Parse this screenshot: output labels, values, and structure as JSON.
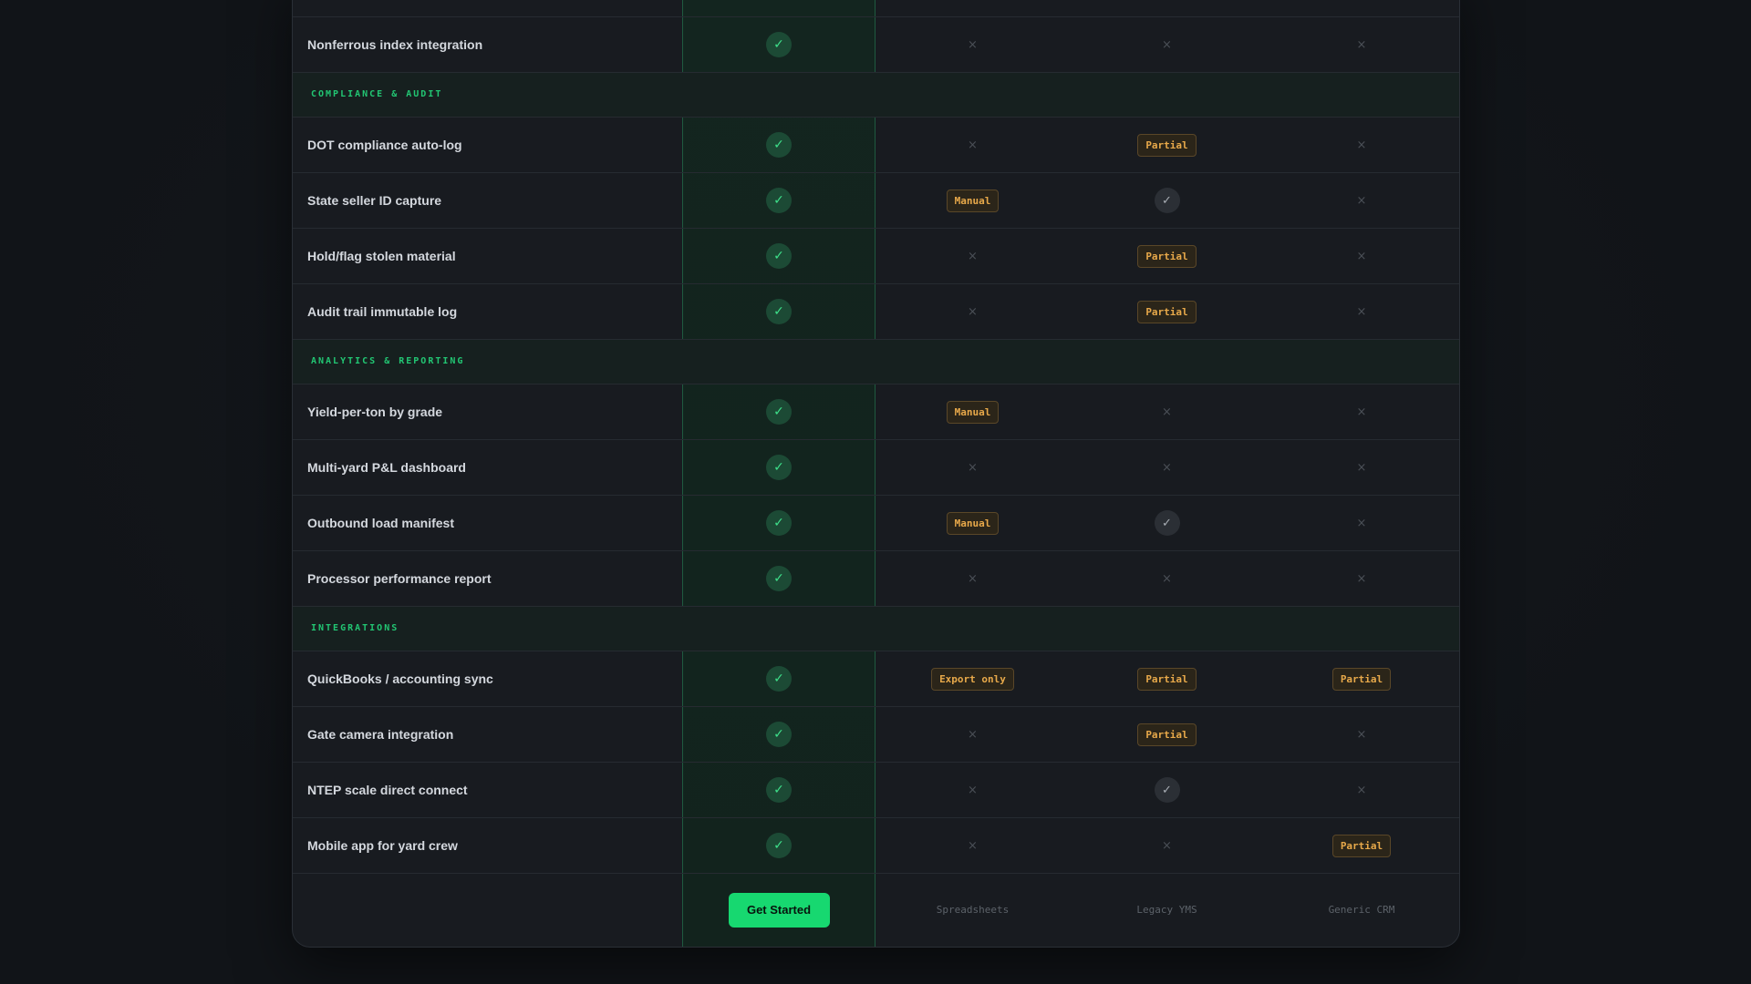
{
  "sections": [
    {
      "label": "",
      "features": [
        {
          "name": "Nonferrous index integration",
          "ours": "check",
          "spreadsheets": "x",
          "legacy_yms": "x",
          "generic_crm": "x"
        }
      ]
    },
    {
      "label": "COMPLIANCE & AUDIT",
      "features": [
        {
          "name": "DOT compliance auto-log",
          "ours": "check",
          "spreadsheets": "x",
          "legacy_yms": "Partial",
          "generic_crm": "x"
        },
        {
          "name": "State seller ID capture",
          "ours": "check",
          "spreadsheets": "Manual",
          "legacy_yms": "check",
          "generic_crm": "x"
        },
        {
          "name": "Hold/flag stolen material",
          "ours": "check",
          "spreadsheets": "x",
          "legacy_yms": "Partial",
          "generic_crm": "x"
        },
        {
          "name": "Audit trail immutable log",
          "ours": "check",
          "spreadsheets": "x",
          "legacy_yms": "Partial",
          "generic_crm": "x"
        }
      ]
    },
    {
      "label": "ANALYTICS & REPORTING",
      "features": [
        {
          "name": "Yield-per-ton by grade",
          "ours": "check",
          "spreadsheets": "Manual",
          "legacy_yms": "x",
          "generic_crm": "x"
        },
        {
          "name": "Multi-yard P&L dashboard",
          "ours": "check",
          "spreadsheets": "x",
          "legacy_yms": "x",
          "generic_crm": "x"
        },
        {
          "name": "Outbound load manifest",
          "ours": "check",
          "spreadsheets": "Manual",
          "legacy_yms": "check",
          "generic_crm": "x"
        },
        {
          "name": "Processor performance report",
          "ours": "check",
          "spreadsheets": "x",
          "legacy_yms": "x",
          "generic_crm": "x"
        }
      ]
    },
    {
      "label": "INTEGRATIONS",
      "features": [
        {
          "name": "QuickBooks / accounting sync",
          "ours": "check",
          "spreadsheets": "Export only",
          "legacy_yms": "Partial",
          "generic_crm": "Partial"
        },
        {
          "name": "Gate camera integration",
          "ours": "check",
          "spreadsheets": "x",
          "legacy_yms": "Partial",
          "generic_crm": "x"
        },
        {
          "name": "NTEP scale direct connect",
          "ours": "check",
          "spreadsheets": "x",
          "legacy_yms": "check",
          "generic_crm": "x"
        },
        {
          "name": "Mobile app for yard crew",
          "ours": "check",
          "spreadsheets": "x",
          "legacy_yms": "x",
          "generic_crm": "Partial"
        }
      ]
    }
  ],
  "footer": {
    "cta_label": "Get Started",
    "col1": "Spreadsheets",
    "col2": "Legacy YMS",
    "col3": "Generic CRM"
  },
  "icons": {
    "check": "check-icon",
    "x": "x-icon"
  },
  "colors": {
    "accent": "#17d870",
    "section_label": "#22c673",
    "badge_text": "#e8a94a",
    "card_bg": "#181b20",
    "ours_column_bg": "#13251f"
  }
}
